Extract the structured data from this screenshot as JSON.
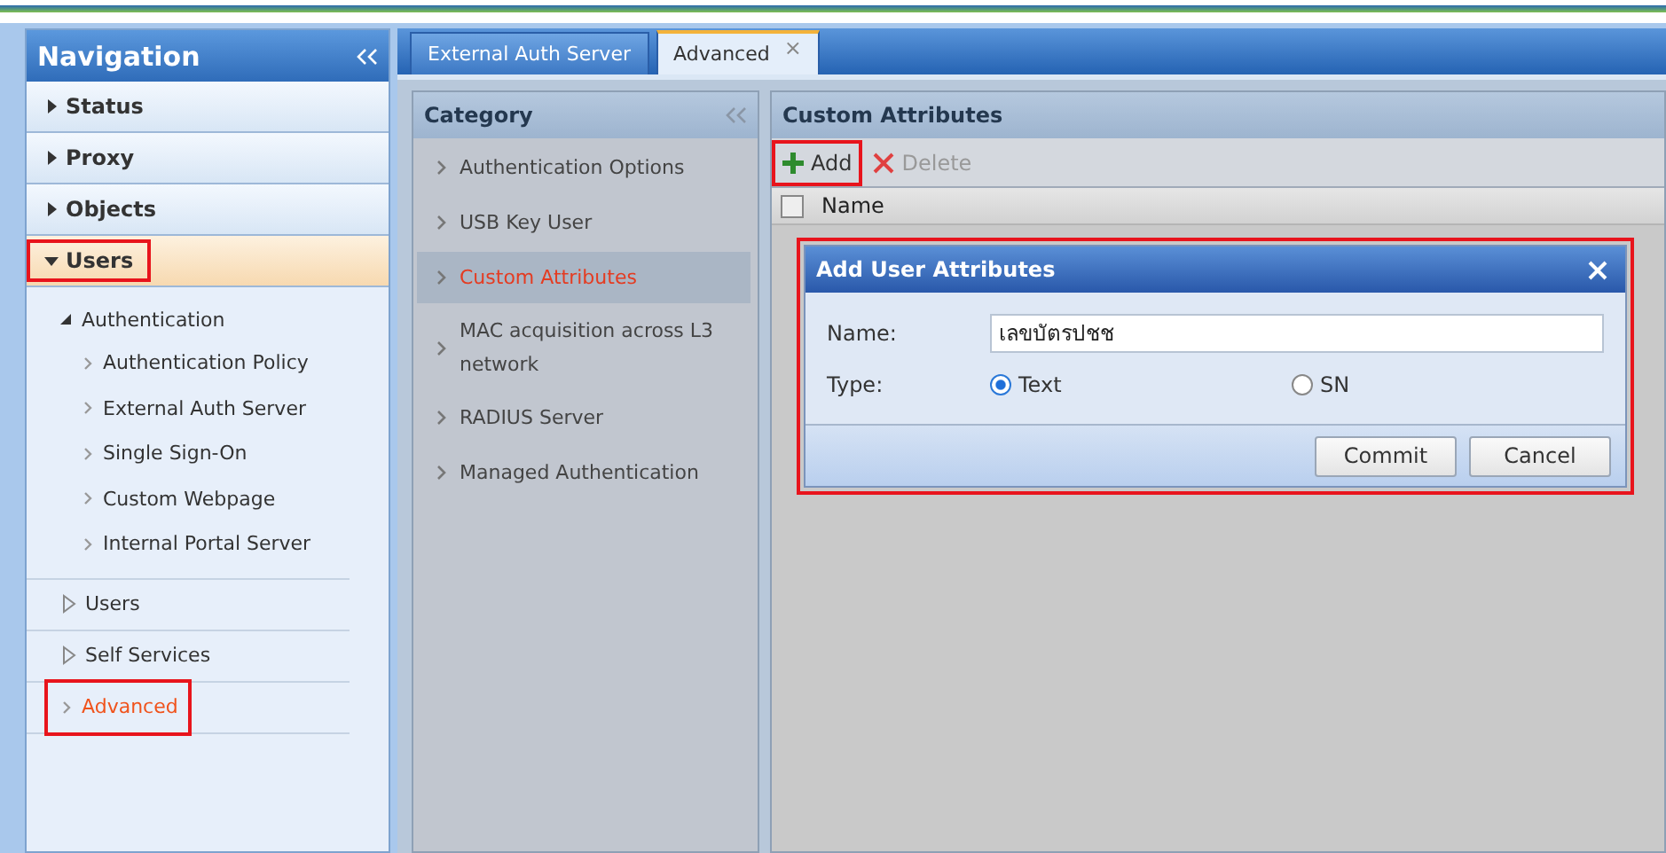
{
  "navigation": {
    "title": "Navigation",
    "sections": [
      {
        "label": "Status",
        "expanded": false,
        "highlighted": false
      },
      {
        "label": "Proxy",
        "expanded": false,
        "highlighted": false
      },
      {
        "label": "Objects",
        "expanded": false,
        "highlighted": false
      },
      {
        "label": "Users",
        "expanded": true,
        "highlighted": true
      }
    ],
    "tree": [
      {
        "label": "Authentication",
        "kind": "group",
        "expanded": true,
        "selected": false,
        "highlighted": false,
        "children": [
          {
            "label": "Authentication Policy",
            "selected": false,
            "highlighted": false
          },
          {
            "label": "External Auth Server",
            "selected": false,
            "highlighted": false
          },
          {
            "label": "Single Sign-On",
            "selected": false,
            "highlighted": false
          },
          {
            "label": "Custom Webpage",
            "selected": false,
            "highlighted": false
          },
          {
            "label": "Internal Portal Server",
            "selected": false,
            "highlighted": false
          }
        ]
      },
      {
        "label": "Users",
        "kind": "group",
        "expanded": false,
        "selected": false,
        "highlighted": false
      },
      {
        "label": "Self Services",
        "kind": "group",
        "expanded": false,
        "selected": false,
        "highlighted": false
      },
      {
        "label": "Advanced",
        "kind": "leaf",
        "selected": true,
        "highlighted": true
      }
    ]
  },
  "tabs": [
    {
      "label": "External Auth Server",
      "selected": false,
      "closable": false
    },
    {
      "label": "Advanced",
      "selected": true,
      "closable": true,
      "close_glyph": "×"
    }
  ],
  "category": {
    "title": "Category",
    "items": [
      {
        "label": "Authentication Options",
        "selected": false
      },
      {
        "label": "USB Key User",
        "selected": false
      },
      {
        "label": "Custom Attributes",
        "selected": true
      },
      {
        "label": "MAC acquisition across L3 network",
        "selected": false
      },
      {
        "label": "RADIUS Server",
        "selected": false
      },
      {
        "label": "Managed Authentication",
        "selected": false
      }
    ]
  },
  "custom_attributes": {
    "title": "Custom Attributes",
    "toolbar": [
      {
        "label": "Add",
        "kind": "add",
        "disabled": false,
        "highlighted": true
      },
      {
        "label": "Delete",
        "kind": "delete",
        "disabled": true,
        "highlighted": false
      }
    ],
    "grid": {
      "select_all_checked": false,
      "columns": [
        "Name"
      ]
    }
  },
  "dialog": {
    "title": "Add User Attributes",
    "highlighted": true,
    "name_label": "Name:",
    "name_value": "เลขบัตรปชช",
    "type_label": "Type:",
    "type_options": [
      {
        "label": "Text",
        "selected": true
      },
      {
        "label": "SN",
        "selected": false
      }
    ],
    "buttons": [
      "Commit",
      "Cancel"
    ]
  }
}
